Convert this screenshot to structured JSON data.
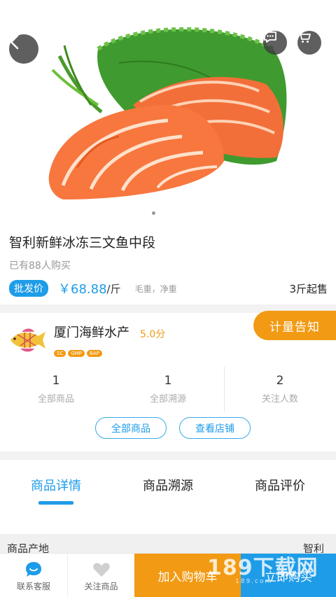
{
  "hero": {
    "image": "salmon-sashimi-photo",
    "page_dots": 1,
    "active_dot": 0
  },
  "icons": {
    "back": "chevron-left-icon",
    "message": "message-icon",
    "cart": "cart-icon",
    "service": "chat-bubble-icon",
    "follow": "heart-icon"
  },
  "product": {
    "title": "智利新鲜冰冻三文鱼中段",
    "sold": "已有88人购买",
    "wholesale_label": "批发价",
    "price": "￥68.88",
    "unit": "/斤",
    "weight_note": "毛重，净重",
    "moq": "3斤起售"
  },
  "shop": {
    "name": "厦门海鲜水产",
    "score": "5.0分",
    "badges": [
      "SC",
      "GMP",
      "BAP"
    ],
    "notify_button": "计量告知",
    "stats": [
      {
        "value": "1",
        "label": "全部商品"
      },
      {
        "value": "1",
        "label": "全部溯源"
      },
      {
        "value": "2",
        "label": "关注人数"
      }
    ],
    "all_products_button": "全部商品",
    "view_shop_button": "查看店铺"
  },
  "tabs": [
    {
      "label": "商品详情",
      "active": true
    },
    {
      "label": "商品溯源",
      "active": false
    },
    {
      "label": "商品评价",
      "active": false
    }
  ],
  "spec": {
    "label": "商品产地",
    "value": "智利"
  },
  "bottom_bar": {
    "service": "联系客服",
    "follow": "关注商品",
    "add_to_cart": "加入购物车",
    "buy_now": "立即购买"
  },
  "watermark": {
    "main": "189下载网",
    "sub": "189.com"
  },
  "colors": {
    "accent_blue": "#1e9ce8",
    "accent_orange": "#f29a13"
  }
}
